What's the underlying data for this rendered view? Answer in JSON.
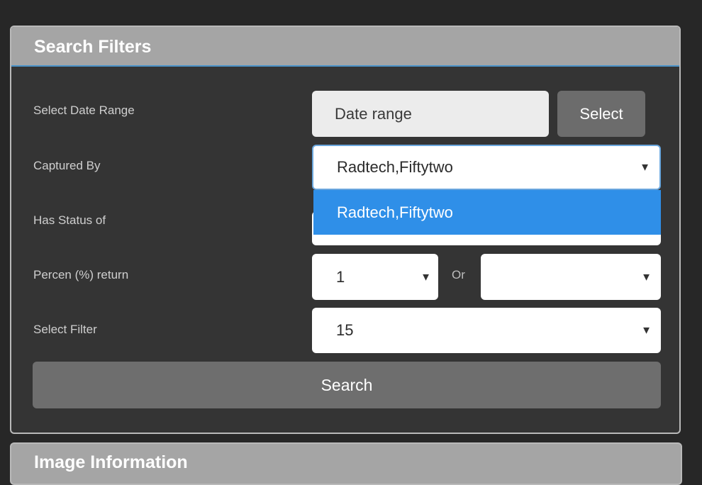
{
  "search_filters": {
    "title": "Search Filters",
    "date_range": {
      "label": "Select Date Range",
      "placeholder": "Date range",
      "button_label": "Select"
    },
    "captured_by": {
      "label": "Captured By",
      "value": "Radtech,Fiftytwo",
      "options": [
        "Radtech,Fiftytwo"
      ],
      "highlighted_option": "Radtech,Fiftytwo"
    },
    "status": {
      "label": "Has Status of",
      "value": ""
    },
    "percent_return": {
      "label": "Percen (%) return",
      "value": "1",
      "or_label": "Or",
      "alt_value": ""
    },
    "filter": {
      "label": "Select Filter",
      "value": "15"
    },
    "search_button_label": "Search",
    "caret_glyph": "▼"
  },
  "image_information": {
    "title": "Image Information"
  },
  "colors": {
    "page_background": "#272727",
    "panel_background": "#343434",
    "header_background": "#a5a5a5",
    "header_accent": "#4a93c9",
    "dropdown_highlight": "#2f8fe8",
    "button_background": "#6e6e6e"
  }
}
